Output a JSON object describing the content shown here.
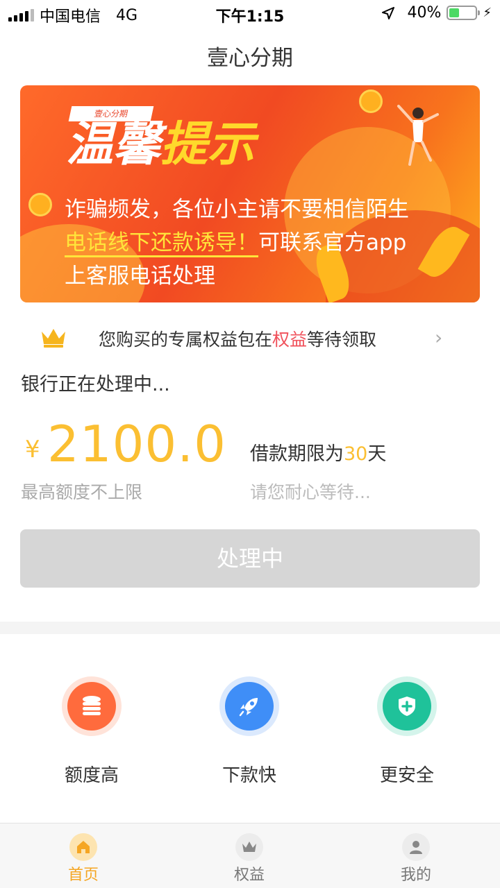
{
  "status_bar": {
    "carrier": "中国电信",
    "network": "4G",
    "time": "下午1:15",
    "battery": "40%",
    "battery_level": 0.4
  },
  "nav": {
    "title": "壹心分期"
  },
  "banner": {
    "tag": "壹心分期",
    "headline_white": "温馨",
    "headline_yellow": "提示",
    "line1": "诈骗频发，各位小主请不要相信陌生",
    "line2_highlight": "电话线下还款诱导！",
    "line2_rest": "可联系官方app",
    "line3": "上客服电话处理"
  },
  "notice": {
    "prefix": "您购买的专属权益包在",
    "highlight": "权益",
    "suffix": "等待领取"
  },
  "status": {
    "processing_text": "银行正在处理中..."
  },
  "loan": {
    "currency": "¥",
    "amount": "2100.0",
    "limit_note": "最高额度不上限",
    "term_prefix": "借款期限为",
    "term_days": "30",
    "term_suffix": "天",
    "wait_note": "请您耐心等待..."
  },
  "button": {
    "label": "处理中"
  },
  "features": [
    {
      "label": "额度高",
      "icon": "coin-stack-icon",
      "color": "#ff6b3d"
    },
    {
      "label": "下款快",
      "icon": "rocket-icon",
      "color": "#3f8ef7"
    },
    {
      "label": "更安全",
      "icon": "shield-plus-icon",
      "color": "#1fc29a"
    }
  ],
  "tabbar": {
    "items": [
      {
        "label": "首页",
        "icon": "home-icon",
        "active": true
      },
      {
        "label": "权益",
        "icon": "crown-icon",
        "active": false
      },
      {
        "label": "我的",
        "icon": "user-icon",
        "active": false
      }
    ],
    "active_color": "#f5a623",
    "inactive_color": "#777777"
  }
}
